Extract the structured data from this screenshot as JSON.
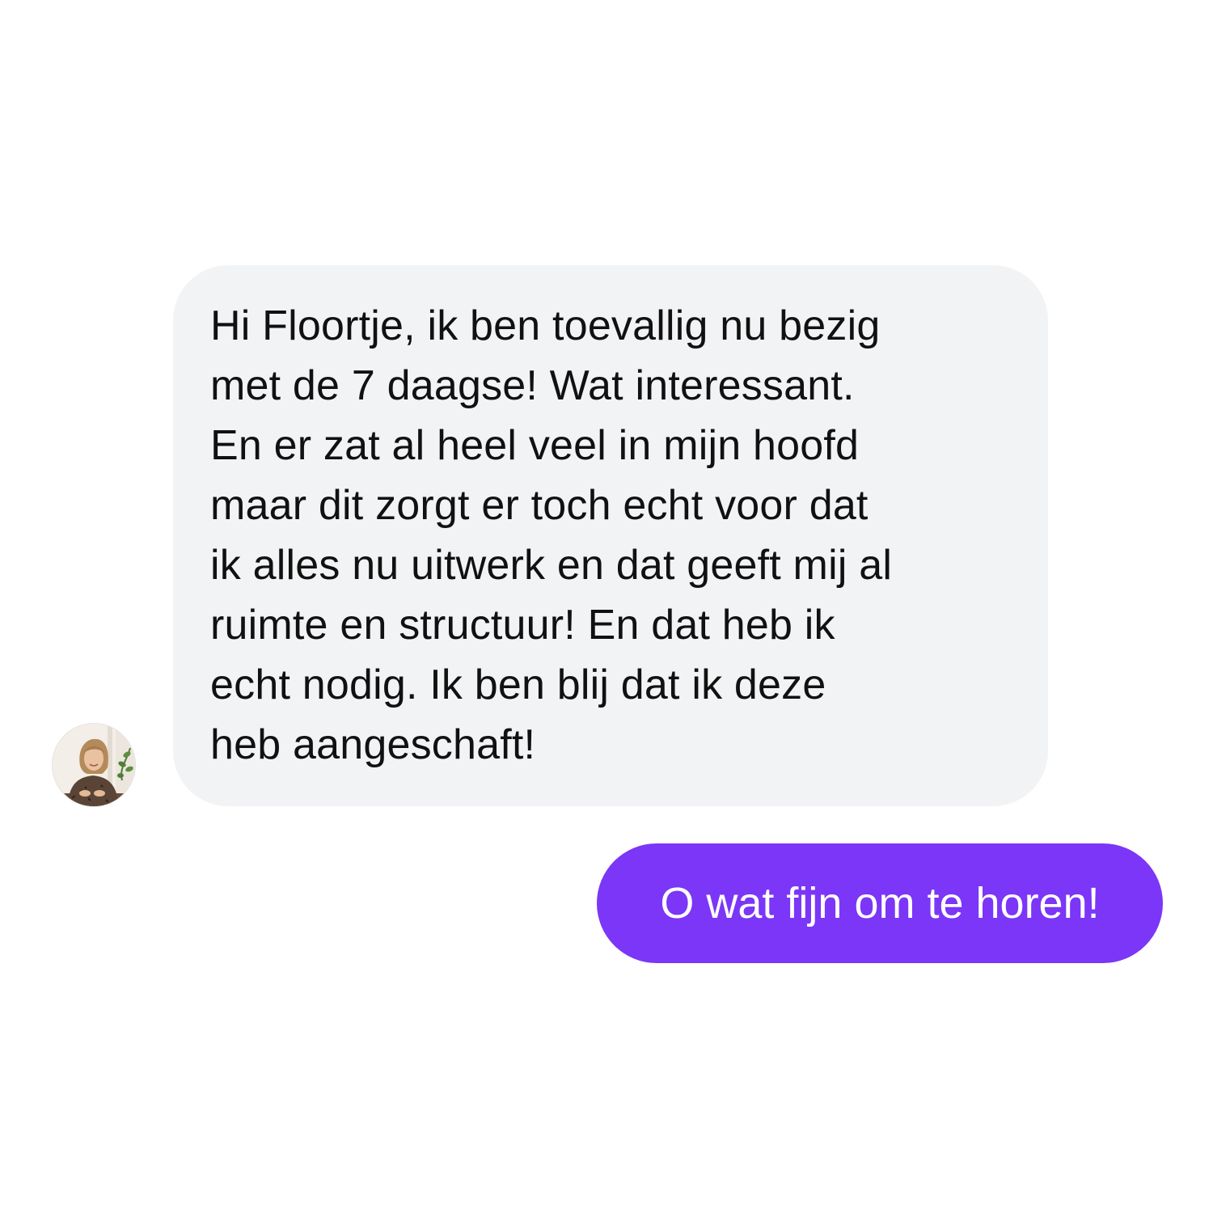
{
  "conversation": {
    "incoming_message": {
      "text": "Hi Floortje, ik ben toevallig nu bezig\nmet de 7 daagse! Wat interessant.\nEn er zat al heel veel in mijn hoofd\nmaar dit zorgt er toch echt voor dat\nik alles nu uitwerk en dat geeft mij al\nruimte en structuur! En dat heb ik\necht nodig. Ik ben blij dat ik deze\nheb aangeschaft!",
      "bubble_color": "#f2f3f5",
      "text_color": "#111111",
      "avatar_icon": "user-avatar-photo"
    },
    "outgoing_message": {
      "text": "O wat fijn om te horen!",
      "bubble_color": "#7b36f7",
      "text_color": "#ffffff"
    }
  }
}
